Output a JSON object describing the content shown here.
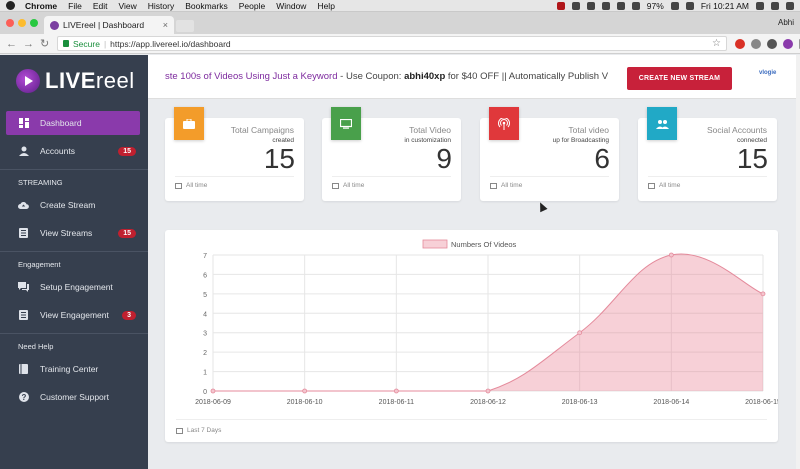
{
  "menubar": {
    "app": "Chrome",
    "items": [
      "File",
      "Edit",
      "View",
      "History",
      "Bookmarks",
      "People",
      "Window",
      "Help"
    ],
    "battery": "97%",
    "clock": "Fri 10:21 AM"
  },
  "browser": {
    "tab_title": "LIVEreel | Dashboard",
    "secure_label": "Secure",
    "url": "https://app.livereel.io/dashboard",
    "profile": "Abhi"
  },
  "sidebar": {
    "logo_bold": "LIVE",
    "logo_light": "reel",
    "main_items": [
      {
        "label": "Dashboard",
        "icon": "dashboard-icon",
        "active": true
      },
      {
        "label": "Accounts",
        "icon": "user-icon",
        "badge": "15"
      }
    ],
    "sections": [
      {
        "title": "STREAMING",
        "items": [
          {
            "label": "Create Stream",
            "icon": "cloud-upload-icon"
          },
          {
            "label": "View Streams",
            "icon": "list-icon",
            "badge": "15"
          }
        ]
      },
      {
        "title": "Engagement",
        "items": [
          {
            "label": "Setup Engagement",
            "icon": "chat-icon"
          },
          {
            "label": "View Engagement",
            "icon": "list-icon",
            "badge": "3"
          }
        ]
      },
      {
        "title": "Need Help",
        "items": [
          {
            "label": "Training Center",
            "icon": "book-icon"
          },
          {
            "label": "Customer Support",
            "icon": "help-icon"
          }
        ]
      }
    ]
  },
  "promo": {
    "text_a": "ste 100s of Videos Using Just a Keyword",
    "text_b": " - Use Coupon: ",
    "coupon": "abhi40xp",
    "text_c": " for $40 OFF || Automatically Publish V",
    "cta": "CREATE NEW STREAM",
    "partner_logo": "vlogie"
  },
  "stats": [
    {
      "label": "Total Campaigns",
      "sub": "created",
      "value": "15",
      "foot": "All time",
      "color": "#f39c2a",
      "icon": "briefcase-icon"
    },
    {
      "label": "Total Video",
      "sub": "in customization",
      "value": "9",
      "foot": "All time",
      "color": "#49a04b",
      "icon": "monitor-icon"
    },
    {
      "label": "Total video",
      "sub": "up for Broadcasting",
      "value": "6",
      "foot": "All time",
      "color": "#e0383b",
      "icon": "broadcast-icon"
    },
    {
      "label": "Social Accounts",
      "sub": "connected",
      "value": "15",
      "foot": "All time",
      "color": "#21a9c6",
      "icon": "people-icon"
    }
  ],
  "chart_footer": "Last 7 Days",
  "colors": {
    "sidebar_bg": "#363f4e",
    "active_item": "#8a3aab",
    "badge": "#c0202f",
    "cta": "#c8213a",
    "series_fill": "rgba(232,120,140,0.35)",
    "series_line": "#e48a9b"
  },
  "chart_data": {
    "type": "area",
    "x": [
      "2018-06-09",
      "2018-06-10",
      "2018-06-11",
      "2018-06-12",
      "2018-06-13",
      "2018-06-14",
      "2018-06-15"
    ],
    "series": [
      {
        "name": "Numbers Of Videos",
        "values": [
          0,
          0,
          0,
          0,
          3,
          7,
          5
        ]
      }
    ],
    "ylim": [
      0,
      7
    ],
    "yticks": [
      0,
      1,
      2,
      3,
      4,
      5,
      6,
      7
    ],
    "legend": "top",
    "grid": true
  }
}
